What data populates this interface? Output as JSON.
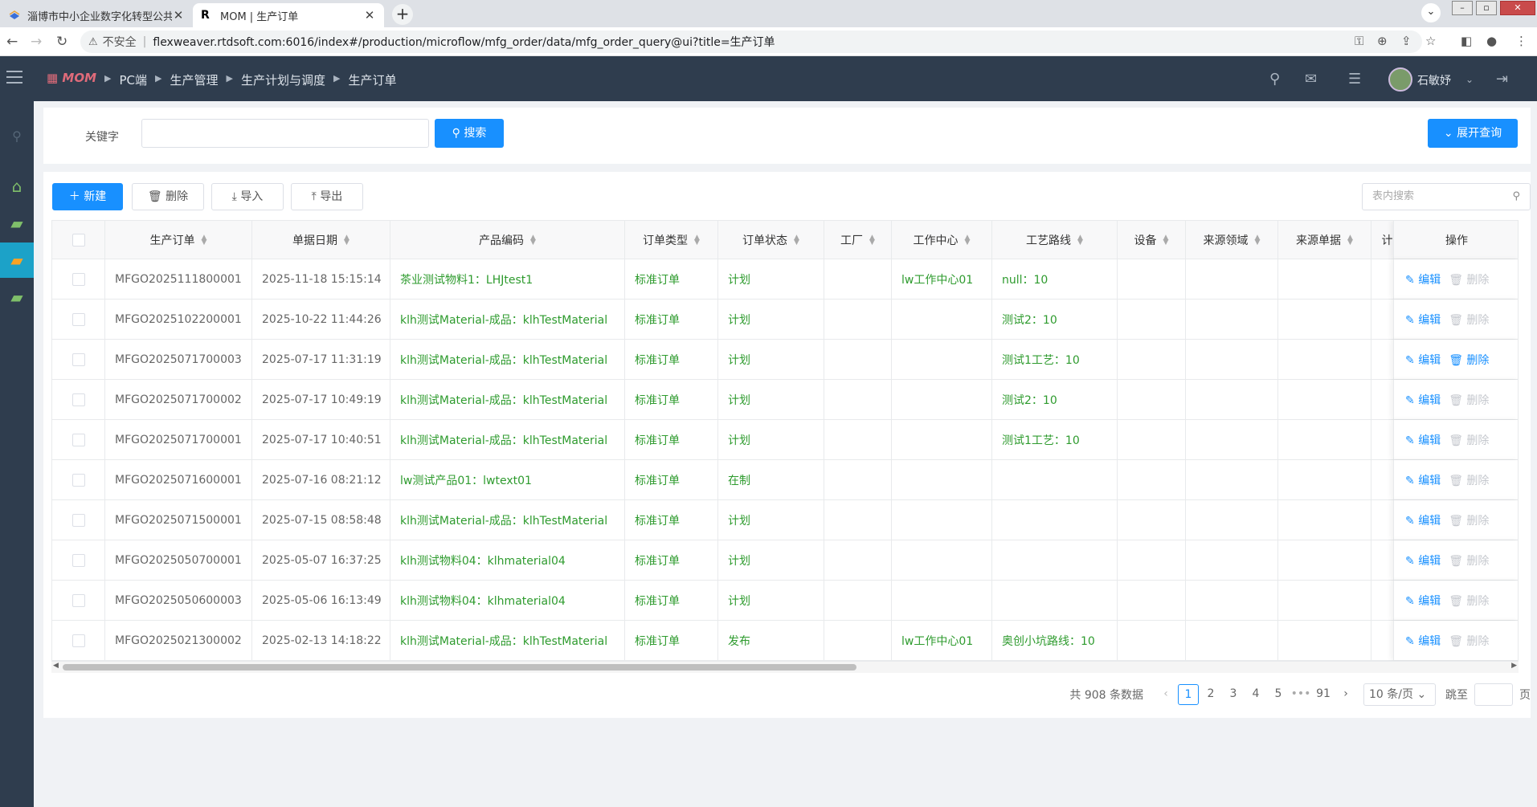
{
  "browser": {
    "tabs": [
      {
        "title": "淄博市中小企业数字化转型公共服务平台"
      },
      {
        "title": "MOM | 生产订单"
      }
    ],
    "new_tab": "+",
    "insecure_label": "不安全",
    "url": "flexweaver.rtdsoft.com:6016/index#/production/microflow/mfg_order/data/mfg_order_query@ui?title=生产订单"
  },
  "app": {
    "logo": "MOM",
    "breadcrumb": [
      "PC端",
      "生产管理",
      "生产计划与调度",
      "生产订单"
    ],
    "user_name": "石敏妤"
  },
  "search": {
    "keyword_label": "关键字",
    "keyword_value": "",
    "search_label": "搜索",
    "expand_label": "展开查询"
  },
  "toolbar": {
    "new_label": "新建",
    "delete_label": "删除",
    "import_label": "导入",
    "export_label": "导出",
    "table_search_placeholder": "表内搜索"
  },
  "table": {
    "columns": [
      "生产订单",
      "单据日期",
      "产品编码",
      "订单类型",
      "订单状态",
      "工厂",
      "工作中心",
      "工艺路线",
      "设备",
      "来源领域",
      "来源单据",
      "计"
    ],
    "ops_header": "操作",
    "edit_label": "编辑",
    "delete_label": "删除",
    "rows": [
      {
        "order": "MFGO2025111800001",
        "date": "2025-11-18 15:15:14",
        "product": "茶业测试物料1：LHJtest1",
        "type": "标准订单",
        "status": "计划",
        "factory": "",
        "wc": "lw工作中心01",
        "route": "null：10",
        "equip": "",
        "src_domain": "",
        "src_doc": "",
        "del_enabled": false
      },
      {
        "order": "MFGO2025102200001",
        "date": "2025-10-22 11:44:26",
        "product": "klh测试Material-成品：klhTestMaterial",
        "type": "标准订单",
        "status": "计划",
        "factory": "",
        "wc": "",
        "route": "测试2：10",
        "equip": "",
        "src_domain": "",
        "src_doc": "",
        "del_enabled": false
      },
      {
        "order": "MFGO2025071700003",
        "date": "2025-07-17 11:31:19",
        "product": "klh测试Material-成品：klhTestMaterial",
        "type": "标准订单",
        "status": "计划",
        "factory": "",
        "wc": "",
        "route": "测试1工艺：10",
        "equip": "",
        "src_domain": "",
        "src_doc": "",
        "del_enabled": true
      },
      {
        "order": "MFGO2025071700002",
        "date": "2025-07-17 10:49:19",
        "product": "klh测试Material-成品：klhTestMaterial",
        "type": "标准订单",
        "status": "计划",
        "factory": "",
        "wc": "",
        "route": "测试2：10",
        "equip": "",
        "src_domain": "",
        "src_doc": "",
        "del_enabled": false
      },
      {
        "order": "MFGO2025071700001",
        "date": "2025-07-17 10:40:51",
        "product": "klh测试Material-成品：klhTestMaterial",
        "type": "标准订单",
        "status": "计划",
        "factory": "",
        "wc": "",
        "route": "测试1工艺：10",
        "equip": "",
        "src_domain": "",
        "src_doc": "",
        "del_enabled": false
      },
      {
        "order": "MFGO2025071600001",
        "date": "2025-07-16 08:21:12",
        "product": "lw测试产品01：lwtext01",
        "type": "标准订单",
        "status": "在制",
        "factory": "",
        "wc": "",
        "route": "",
        "equip": "",
        "src_domain": "",
        "src_doc": "",
        "del_enabled": false
      },
      {
        "order": "MFGO2025071500001",
        "date": "2025-07-15 08:58:48",
        "product": "klh测试Material-成品：klhTestMaterial",
        "type": "标准订单",
        "status": "计划",
        "factory": "",
        "wc": "",
        "route": "",
        "equip": "",
        "src_domain": "",
        "src_doc": "",
        "del_enabled": false
      },
      {
        "order": "MFGO2025050700001",
        "date": "2025-05-07 16:37:25",
        "product": "klh测试物料04：klhmaterial04",
        "type": "标准订单",
        "status": "计划",
        "factory": "",
        "wc": "",
        "route": "",
        "equip": "",
        "src_domain": "",
        "src_doc": "",
        "del_enabled": false
      },
      {
        "order": "MFGO2025050600003",
        "date": "2025-05-06 16:13:49",
        "product": "klh测试物料04：klhmaterial04",
        "type": "标准订单",
        "status": "计划",
        "factory": "",
        "wc": "",
        "route": "",
        "equip": "",
        "src_domain": "",
        "src_doc": "",
        "del_enabled": false
      },
      {
        "order": "MFGO2025021300002",
        "date": "2025-02-13 14:18:22",
        "product": "klh测试Material-成品：klhTestMaterial",
        "type": "标准订单",
        "status": "发布",
        "factory": "",
        "wc": "lw工作中心01",
        "route": "奥创小坑路线：10",
        "equip": "",
        "src_domain": "",
        "src_doc": "",
        "del_enabled": false
      }
    ]
  },
  "pagination": {
    "total_text": "共 908 条数据",
    "pages": [
      "1",
      "2",
      "3",
      "4",
      "5",
      "•••",
      "91"
    ],
    "current": "1",
    "page_size": "10 条/页",
    "jump_label": "跳至",
    "page_suffix": "页"
  },
  "colors": {
    "accent": "#1890ff",
    "link_green": "#2e9b2e",
    "header_dark": "#2f3d4e",
    "active_sidebar": "#1ca2c8"
  }
}
